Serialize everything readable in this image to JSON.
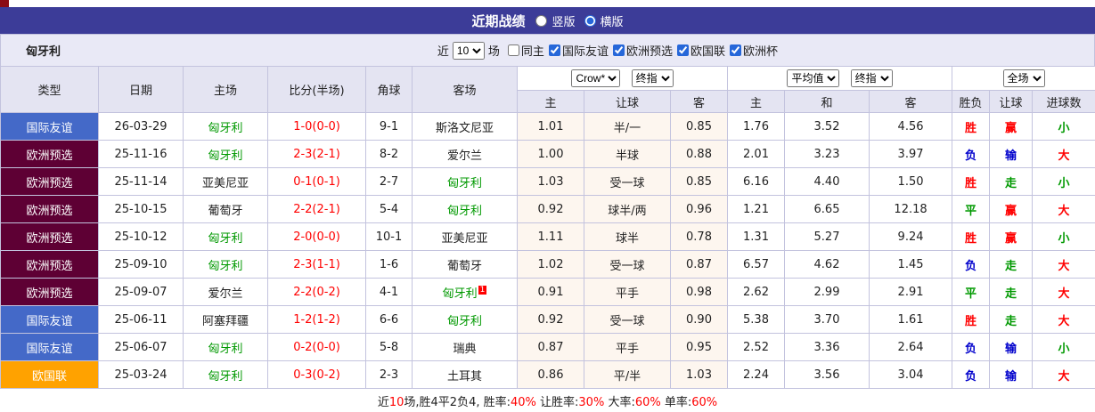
{
  "title_bar": {
    "title": "近期战绩",
    "options": [
      {
        "label": "竖版",
        "selected": false
      },
      {
        "label": "横版",
        "selected": true
      }
    ]
  },
  "filter_bar": {
    "team": "匈牙利",
    "recent_prefix": "近",
    "recent_value": "10",
    "recent_suffix": "场",
    "checkboxes": [
      {
        "label": "同主",
        "checked": false
      },
      {
        "label": "国际友谊",
        "checked": true
      },
      {
        "label": "欧洲预选",
        "checked": true
      },
      {
        "label": "欧国联",
        "checked": true
      },
      {
        "label": "欧洲杯",
        "checked": true
      }
    ]
  },
  "table": {
    "static_headers": [
      "类型",
      "日期",
      "主场",
      "比分(半场)",
      "角球",
      "客场"
    ],
    "odds1_selects": [
      "Crow*",
      "终指"
    ],
    "odds1_headers": [
      "主",
      "让球",
      "客"
    ],
    "odds2_selects": [
      "平均值",
      "终指"
    ],
    "odds2_headers": [
      "主",
      "和",
      "客"
    ],
    "result_select": "全场",
    "result_headers": [
      "胜负",
      "让球",
      "进球数"
    ],
    "rows": [
      {
        "type": "国际友谊",
        "type_class": "t-friendly",
        "date": "26-03-29",
        "home": "匈牙利",
        "home_class": "c-green",
        "score": "1-0(0-0)",
        "corner": "9-1",
        "away": "斯洛文尼亚",
        "away_class": "",
        "away_sup": "",
        "o1h": "1.01",
        "o1x": "半/一",
        "o1a": "0.85",
        "o2h": "1.76",
        "o2x": "3.52",
        "o2a": "4.56",
        "res": "胜",
        "res_class": "c-red",
        "let": "赢",
        "let_class": "c-red",
        "goal": "小",
        "goal_class": "c-green"
      },
      {
        "type": "欧洲预选",
        "type_class": "t-qualifier",
        "date": "25-11-16",
        "home": "匈牙利",
        "home_class": "c-green",
        "score": "2-3(2-1)",
        "corner": "8-2",
        "away": "爱尔兰",
        "away_class": "",
        "away_sup": "",
        "o1h": "1.00",
        "o1x": "半球",
        "o1a": "0.88",
        "o2h": "2.01",
        "o2x": "3.23",
        "o2a": "3.97",
        "res": "负",
        "res_class": "c-blue",
        "let": "输",
        "let_class": "c-blue",
        "goal": "大",
        "goal_class": "c-red"
      },
      {
        "type": "欧洲预选",
        "type_class": "t-qualifier",
        "date": "25-11-14",
        "home": "亚美尼亚",
        "home_class": "",
        "score": "0-1(0-1)",
        "corner": "2-7",
        "away": "匈牙利",
        "away_class": "c-green",
        "away_sup": "",
        "o1h": "1.03",
        "o1x": "受一球",
        "o1a": "0.85",
        "o2h": "6.16",
        "o2x": "4.40",
        "o2a": "1.50",
        "res": "胜",
        "res_class": "c-red",
        "let": "走",
        "let_class": "c-green",
        "goal": "小",
        "goal_class": "c-green"
      },
      {
        "type": "欧洲预选",
        "type_class": "t-qualifier",
        "date": "25-10-15",
        "home": "葡萄牙",
        "home_class": "",
        "score": "2-2(2-1)",
        "corner": "5-4",
        "away": "匈牙利",
        "away_class": "c-green",
        "away_sup": "",
        "o1h": "0.92",
        "o1x": "球半/两",
        "o1a": "0.96",
        "o2h": "1.21",
        "o2x": "6.65",
        "o2a": "12.18",
        "res": "平",
        "res_class": "c-green",
        "let": "赢",
        "let_class": "c-red",
        "goal": "大",
        "goal_class": "c-red"
      },
      {
        "type": "欧洲预选",
        "type_class": "t-qualifier",
        "date": "25-10-12",
        "home": "匈牙利",
        "home_class": "c-green",
        "score": "2-0(0-0)",
        "corner": "10-1",
        "away": "亚美尼亚",
        "away_class": "",
        "away_sup": "",
        "o1h": "1.11",
        "o1x": "球半",
        "o1a": "0.78",
        "o2h": "1.31",
        "o2x": "5.27",
        "o2a": "9.24",
        "res": "胜",
        "res_class": "c-red",
        "let": "赢",
        "let_class": "c-red",
        "goal": "小",
        "goal_class": "c-green"
      },
      {
        "type": "欧洲预选",
        "type_class": "t-qualifier",
        "date": "25-09-10",
        "home": "匈牙利",
        "home_class": "c-green",
        "score": "2-3(1-1)",
        "corner": "1-6",
        "away": "葡萄牙",
        "away_class": "",
        "away_sup": "",
        "o1h": "1.02",
        "o1x": "受一球",
        "o1a": "0.87",
        "o2h": "6.57",
        "o2x": "4.62",
        "o2a": "1.45",
        "res": "负",
        "res_class": "c-blue",
        "let": "走",
        "let_class": "c-green",
        "goal": "大",
        "goal_class": "c-red"
      },
      {
        "type": "欧洲预选",
        "type_class": "t-qualifier",
        "date": "25-09-07",
        "home": "爱尔兰",
        "home_class": "",
        "score": "2-2(0-2)",
        "corner": "4-1",
        "away": "匈牙利",
        "away_class": "c-green",
        "away_sup": "1",
        "o1h": "0.91",
        "o1x": "平手",
        "o1a": "0.98",
        "o2h": "2.62",
        "o2x": "2.99",
        "o2a": "2.91",
        "res": "平",
        "res_class": "c-green",
        "let": "走",
        "let_class": "c-green",
        "goal": "大",
        "goal_class": "c-red"
      },
      {
        "type": "国际友谊",
        "type_class": "t-friendly",
        "date": "25-06-11",
        "home": "阿塞拜疆",
        "home_class": "",
        "score": "1-2(1-2)",
        "corner": "6-6",
        "away": "匈牙利",
        "away_class": "c-green",
        "away_sup": "",
        "o1h": "0.92",
        "o1x": "受一球",
        "o1a": "0.90",
        "o2h": "5.38",
        "o2x": "3.70",
        "o2a": "1.61",
        "res": "胜",
        "res_class": "c-red",
        "let": "走",
        "let_class": "c-green",
        "goal": "大",
        "goal_class": "c-red"
      },
      {
        "type": "国际友谊",
        "type_class": "t-friendly",
        "date": "25-06-07",
        "home": "匈牙利",
        "home_class": "c-green",
        "score": "0-2(0-0)",
        "corner": "5-8",
        "away": "瑞典",
        "away_class": "",
        "away_sup": "",
        "o1h": "0.87",
        "o1x": "平手",
        "o1a": "0.95",
        "o2h": "2.52",
        "o2x": "3.36",
        "o2a": "2.64",
        "res": "负",
        "res_class": "c-blue",
        "let": "输",
        "let_class": "c-blue",
        "goal": "小",
        "goal_class": "c-green"
      },
      {
        "type": "欧国联",
        "type_class": "t-nations",
        "date": "25-03-24",
        "home": "匈牙利",
        "home_class": "c-green",
        "score": "0-3(0-2)",
        "corner": "2-3",
        "away": "土耳其",
        "away_class": "",
        "away_sup": "",
        "o1h": "0.86",
        "o1x": "平/半",
        "o1a": "1.03",
        "o2h": "2.24",
        "o2x": "3.56",
        "o2a": "3.04",
        "res": "负",
        "res_class": "c-blue",
        "let": "输",
        "let_class": "c-blue",
        "goal": "大",
        "goal_class": "c-red"
      }
    ]
  },
  "footer": {
    "segments": [
      {
        "text": "近",
        "color": "black"
      },
      {
        "text": "10",
        "color": "red"
      },
      {
        "text": "场,胜4平2负4, 胜率:",
        "color": "black"
      },
      {
        "text": "40%",
        "color": "red"
      },
      {
        "text": " 让胜率:",
        "color": "black"
      },
      {
        "text": "30%",
        "color": "red"
      },
      {
        "text": " 大率:",
        "color": "black"
      },
      {
        "text": "60%",
        "color": "red"
      },
      {
        "text": " 单率:",
        "color": "black"
      },
      {
        "text": "60%",
        "color": "red"
      }
    ]
  },
  "colors": {
    "title_bar_bg": "#3c3c98",
    "header_bg": "#e4e4f2",
    "type_friendly": "#4469c8",
    "type_qualifier": "#5e0034",
    "type_nations": "#ffa200",
    "win_red": "#ff0000",
    "loss_blue": "#0000cc",
    "draw_green": "#009900",
    "hungary_green": "#009900"
  }
}
